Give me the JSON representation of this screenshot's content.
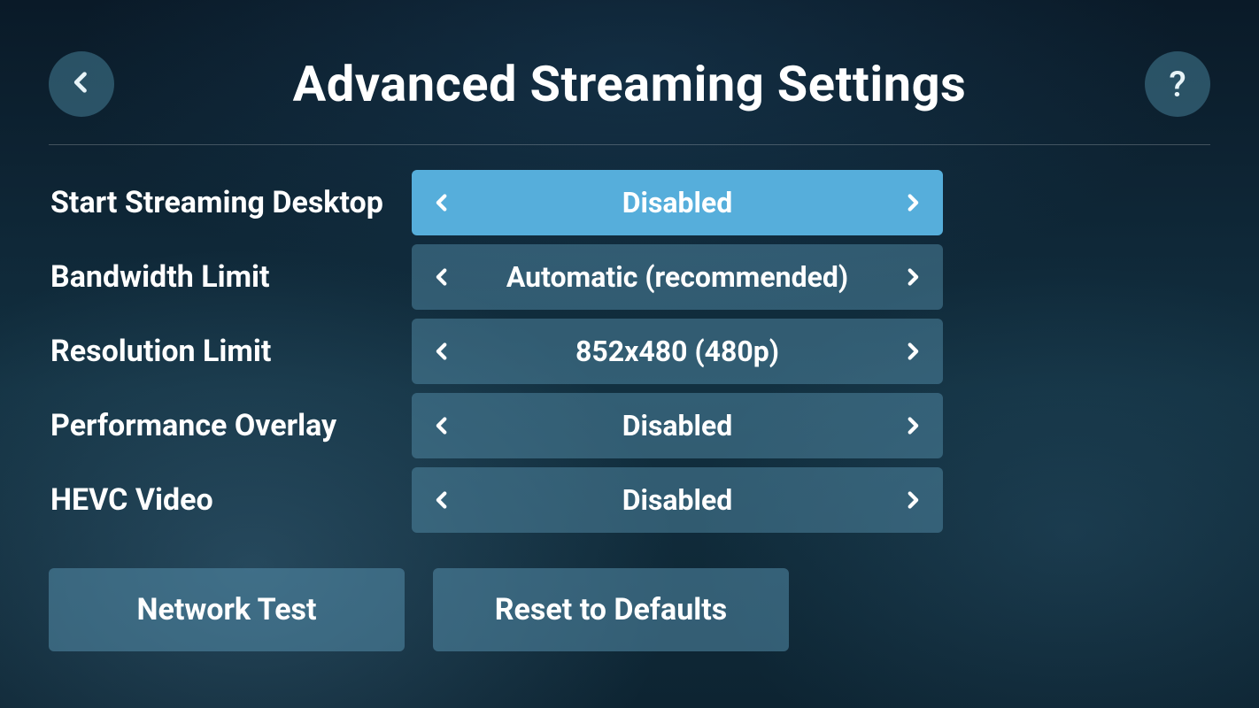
{
  "header": {
    "title": "Advanced Streaming Settings",
    "help_label": "?"
  },
  "settings": [
    {
      "label": "Start Streaming Desktop",
      "value": "Disabled",
      "active": true
    },
    {
      "label": "Bandwidth Limit",
      "value": "Automatic (recommended)",
      "active": false
    },
    {
      "label": "Resolution Limit",
      "value": "852x480 (480p)",
      "active": false
    },
    {
      "label": "Performance Overlay",
      "value": "Disabled",
      "active": false
    },
    {
      "label": "HEVC Video",
      "value": "Disabled",
      "active": false
    }
  ],
  "footer": {
    "network_test": "Network Test",
    "reset_defaults": "Reset to Defaults"
  }
}
